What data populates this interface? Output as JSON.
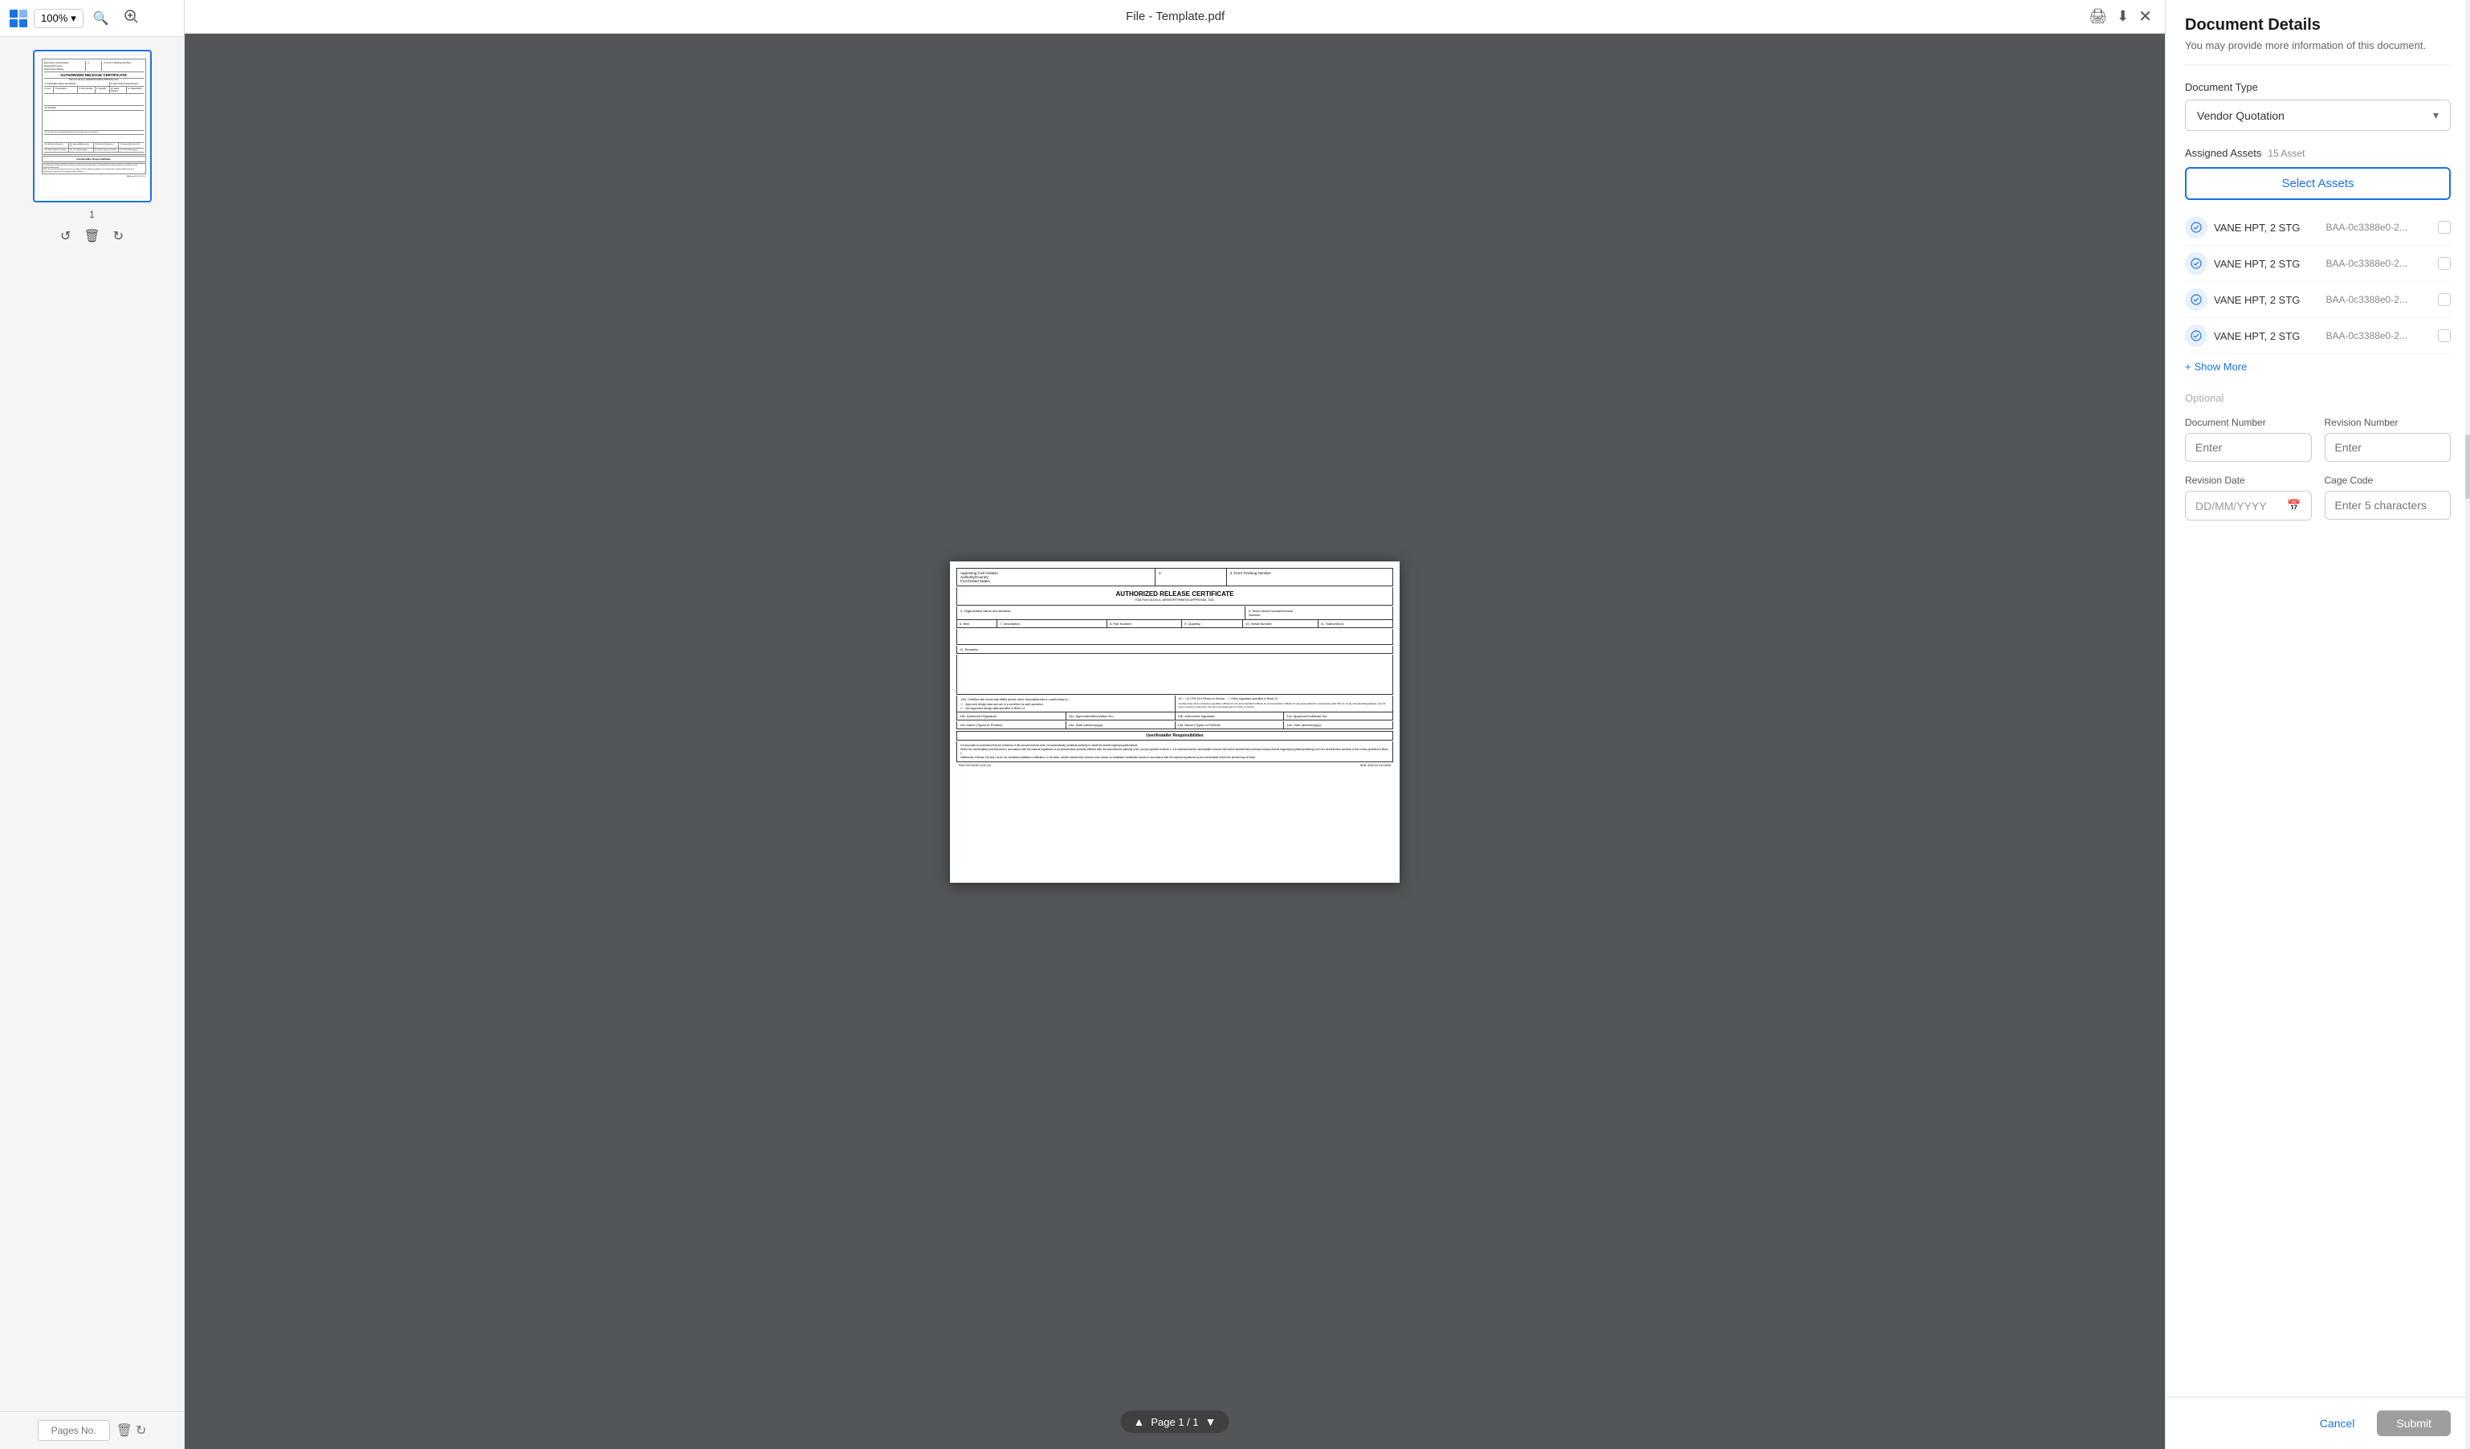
{
  "toolbar": {
    "zoom_level": "100%",
    "zoom_dropdown_label": "100%"
  },
  "header": {
    "title": "File - Template.pdf",
    "close_label": "×"
  },
  "sidebar": {
    "page_number": "1",
    "pages_placeholder": "Pages No."
  },
  "page_nav": {
    "label": "Page 1 / 1"
  },
  "details_panel": {
    "title": "Document Details",
    "subtitle": "You may provide more information of this document.",
    "doc_type_label": "Document Type",
    "doc_type_value": "Vendor Quotation",
    "assigned_assets_label": "Assigned Assets",
    "assigned_assets_count": "15 Asset",
    "select_assets_btn": "Select Assets",
    "show_more_label": "Show More",
    "optional_label": "Optional",
    "doc_number_label": "Document Number",
    "doc_number_placeholder": "Enter",
    "revision_number_label": "Revision Number",
    "revision_number_placeholder": "Enter",
    "revision_date_label": "Revision Date",
    "revision_date_placeholder": "DD/MM/YYYY",
    "cage_code_label": "Cage Code",
    "cage_code_placeholder": "Enter 5 characters",
    "cancel_btn": "Cancel",
    "submit_btn": "Submit",
    "assets": [
      {
        "name": "VANE HPT, 2 STG",
        "id": "BAA-0c3388e0-2..."
      },
      {
        "name": "VANE HPT, 2 STG",
        "id": "BAA-0c3388e0-2..."
      },
      {
        "name": "VANE HPT, 2 STG",
        "id": "BAA-0c3388e0-2..."
      },
      {
        "name": "VANE HPT, 2 STG",
        "id": "BAA-0c3388e0-2..."
      }
    ]
  }
}
